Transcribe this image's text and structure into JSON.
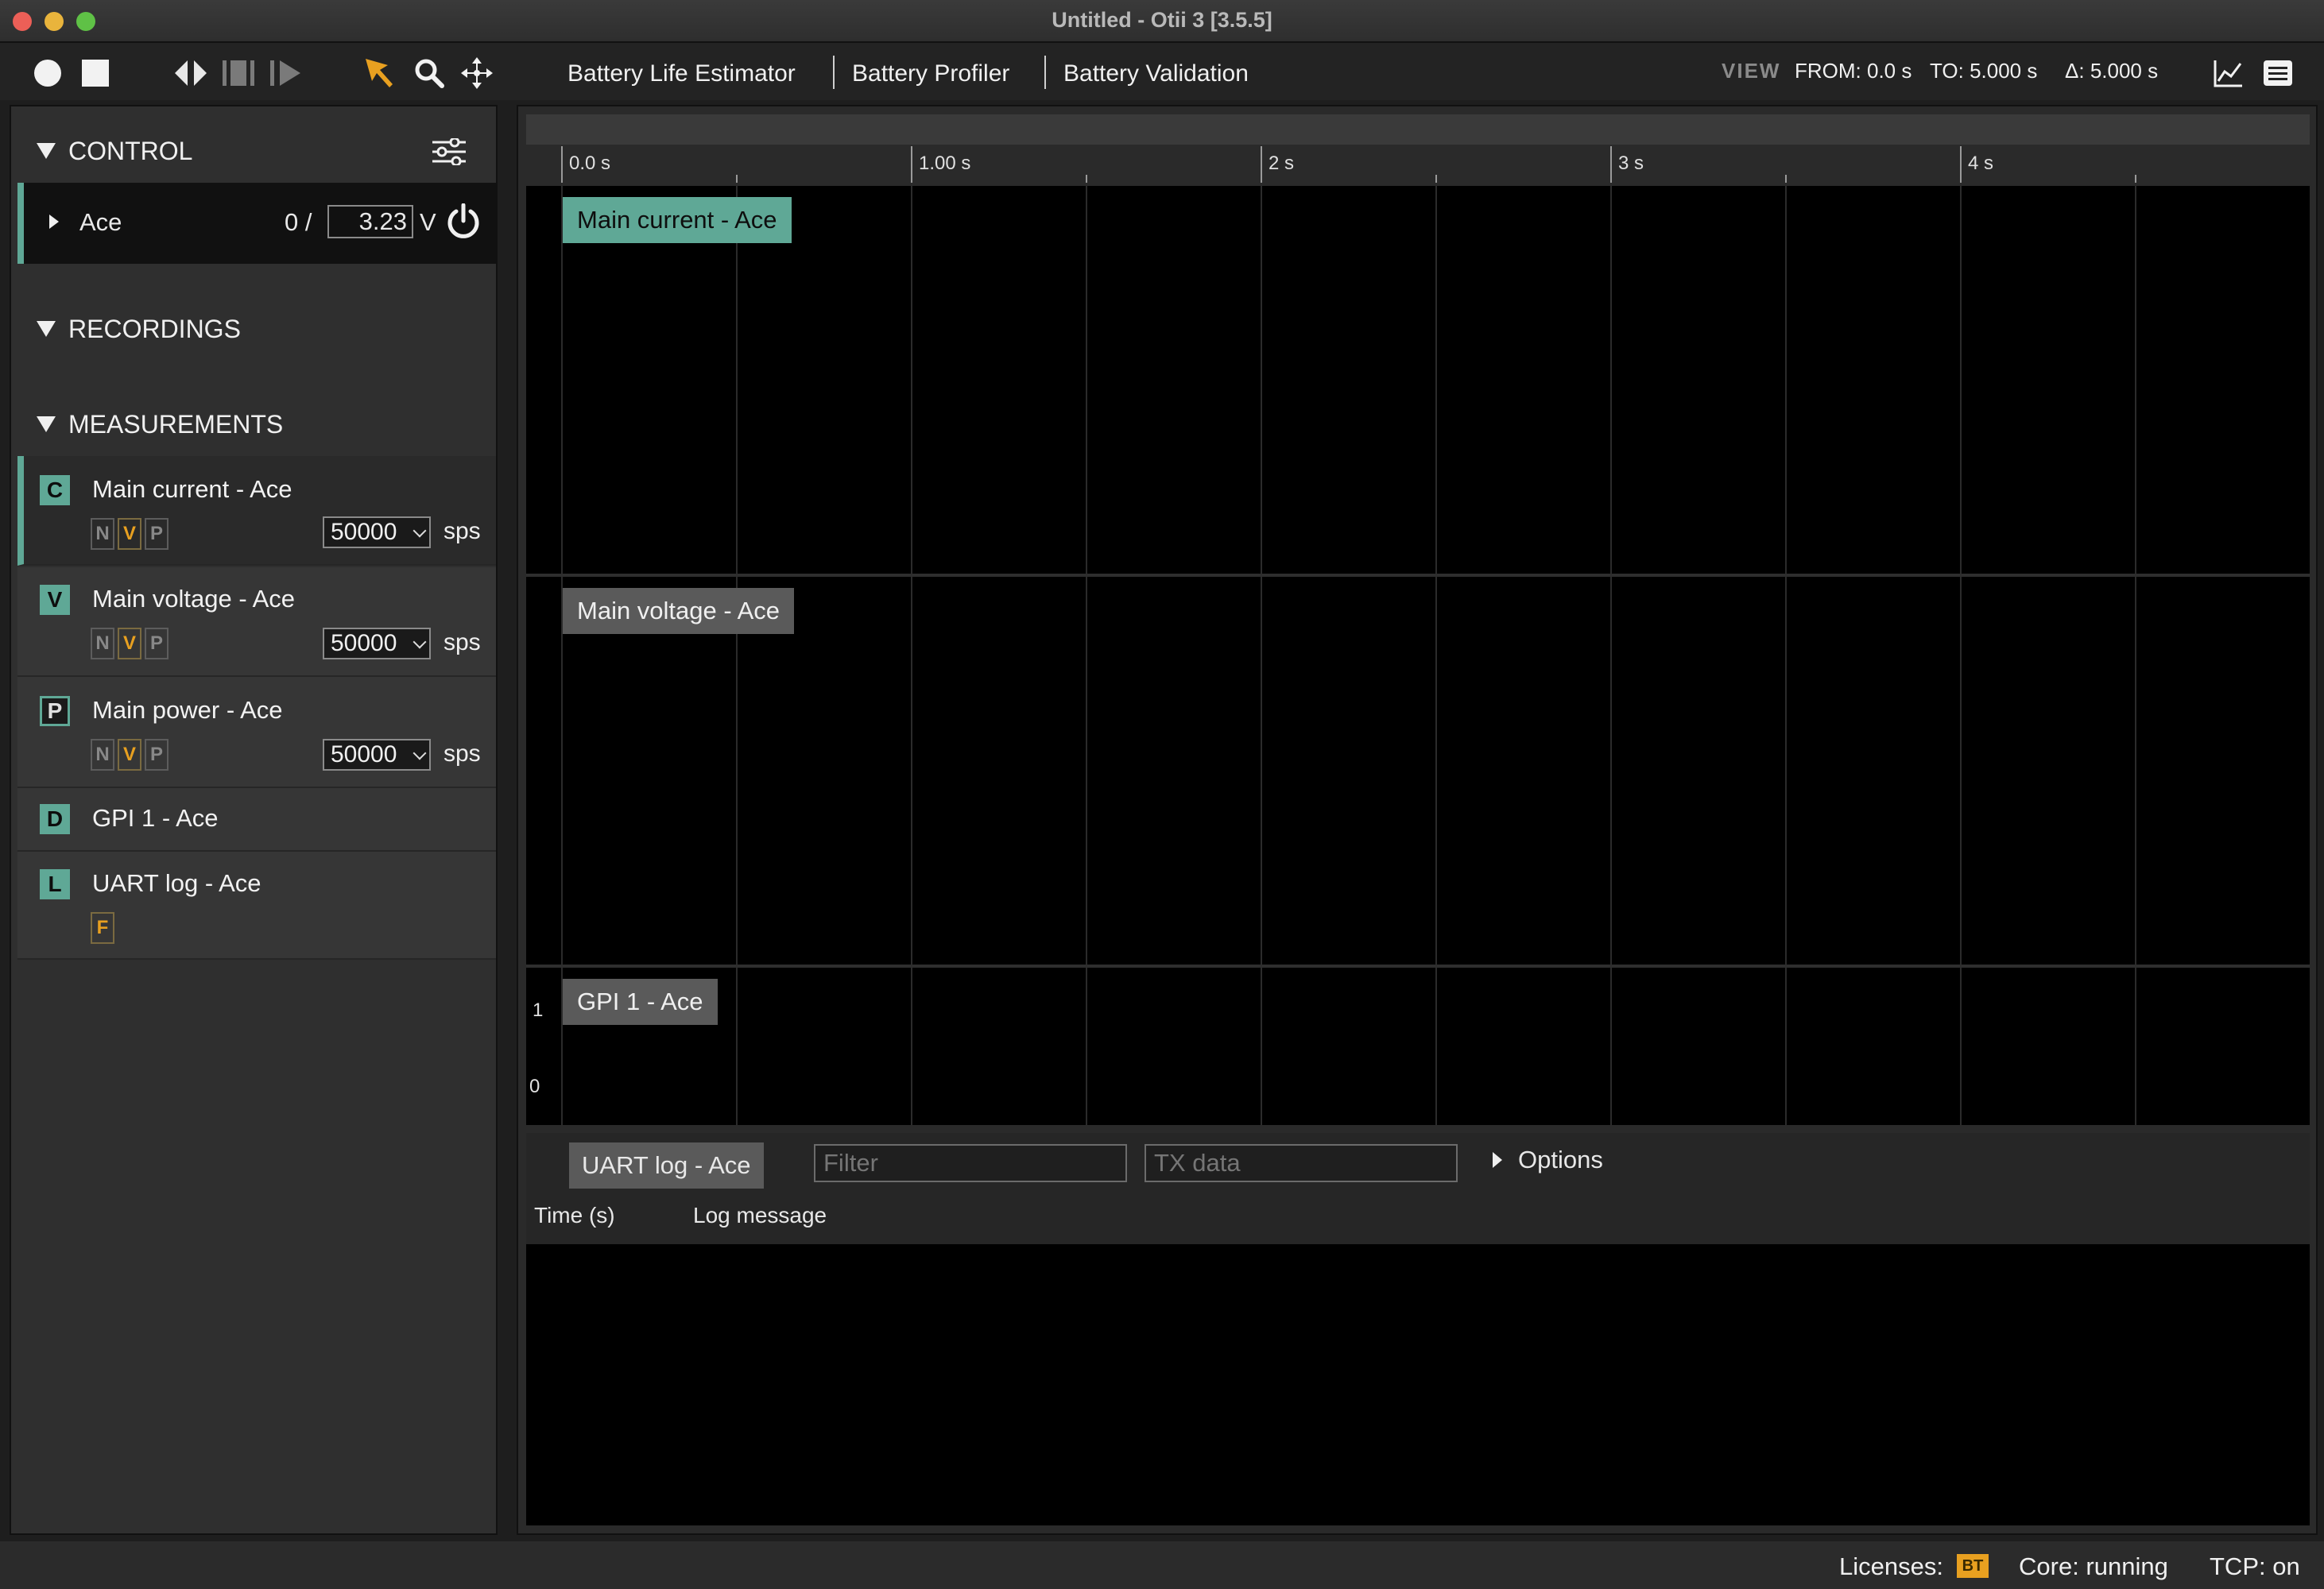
{
  "window": {
    "title": "Untitled - Otii 3 [3.5.5]"
  },
  "toolbar": {
    "menus": [
      "Battery Life Estimator",
      "Battery Profiler",
      "Battery Validation"
    ],
    "view_label": "VIEW",
    "from": "FROM: 0.0 s",
    "to": "TO: 5.000 s",
    "delta": "Δ: 5.000 s"
  },
  "control": {
    "header": "CONTROL",
    "device": "Ace",
    "current_prefix": "0 /",
    "voltage_value": "3.23",
    "voltage_unit": "V"
  },
  "recordings": {
    "header": "RECORDINGS"
  },
  "measurements": {
    "header": "MEASUREMENTS",
    "items": [
      {
        "badge": "C",
        "name": "Main current - Ace",
        "rate": "50000",
        "unit": "sps",
        "flags": [
          "N",
          "V",
          "P"
        ]
      },
      {
        "badge": "V",
        "name": "Main voltage - Ace",
        "rate": "50000",
        "unit": "sps",
        "flags": [
          "N",
          "V",
          "P"
        ]
      },
      {
        "badge": "P",
        "name": "Main power - Ace",
        "rate": "50000",
        "unit": "sps",
        "flags": [
          "N",
          "V",
          "P"
        ]
      },
      {
        "badge": "D",
        "name": "GPI 1 - Ace"
      },
      {
        "badge": "L",
        "name": "UART log - Ace",
        "flags": [
          "F"
        ]
      }
    ]
  },
  "timeline": {
    "ticks": [
      "0.0 s",
      "1.00 s",
      "2 s",
      "3 s",
      "4 s"
    ],
    "tracks": {
      "current": "Main current - Ace",
      "voltage": "Main voltage - Ace",
      "gpi": "GPI 1 - Ace",
      "gpi_high": "1",
      "gpi_low": "0"
    }
  },
  "uart": {
    "label": "UART log - Ace",
    "filter_placeholder": "Filter",
    "tx_placeholder": "TX data",
    "options": "Options",
    "col_time": "Time (s)",
    "col_msg": "Log message"
  },
  "status": {
    "licenses": "Licenses:",
    "license_badge": "BT",
    "core": "Core: running",
    "tcp": "TCP: on"
  },
  "colors": {
    "accent_teal": "#5fa896",
    "highlight_orange": "#e8a020",
    "track_label_gray": "#5a5a5a"
  }
}
